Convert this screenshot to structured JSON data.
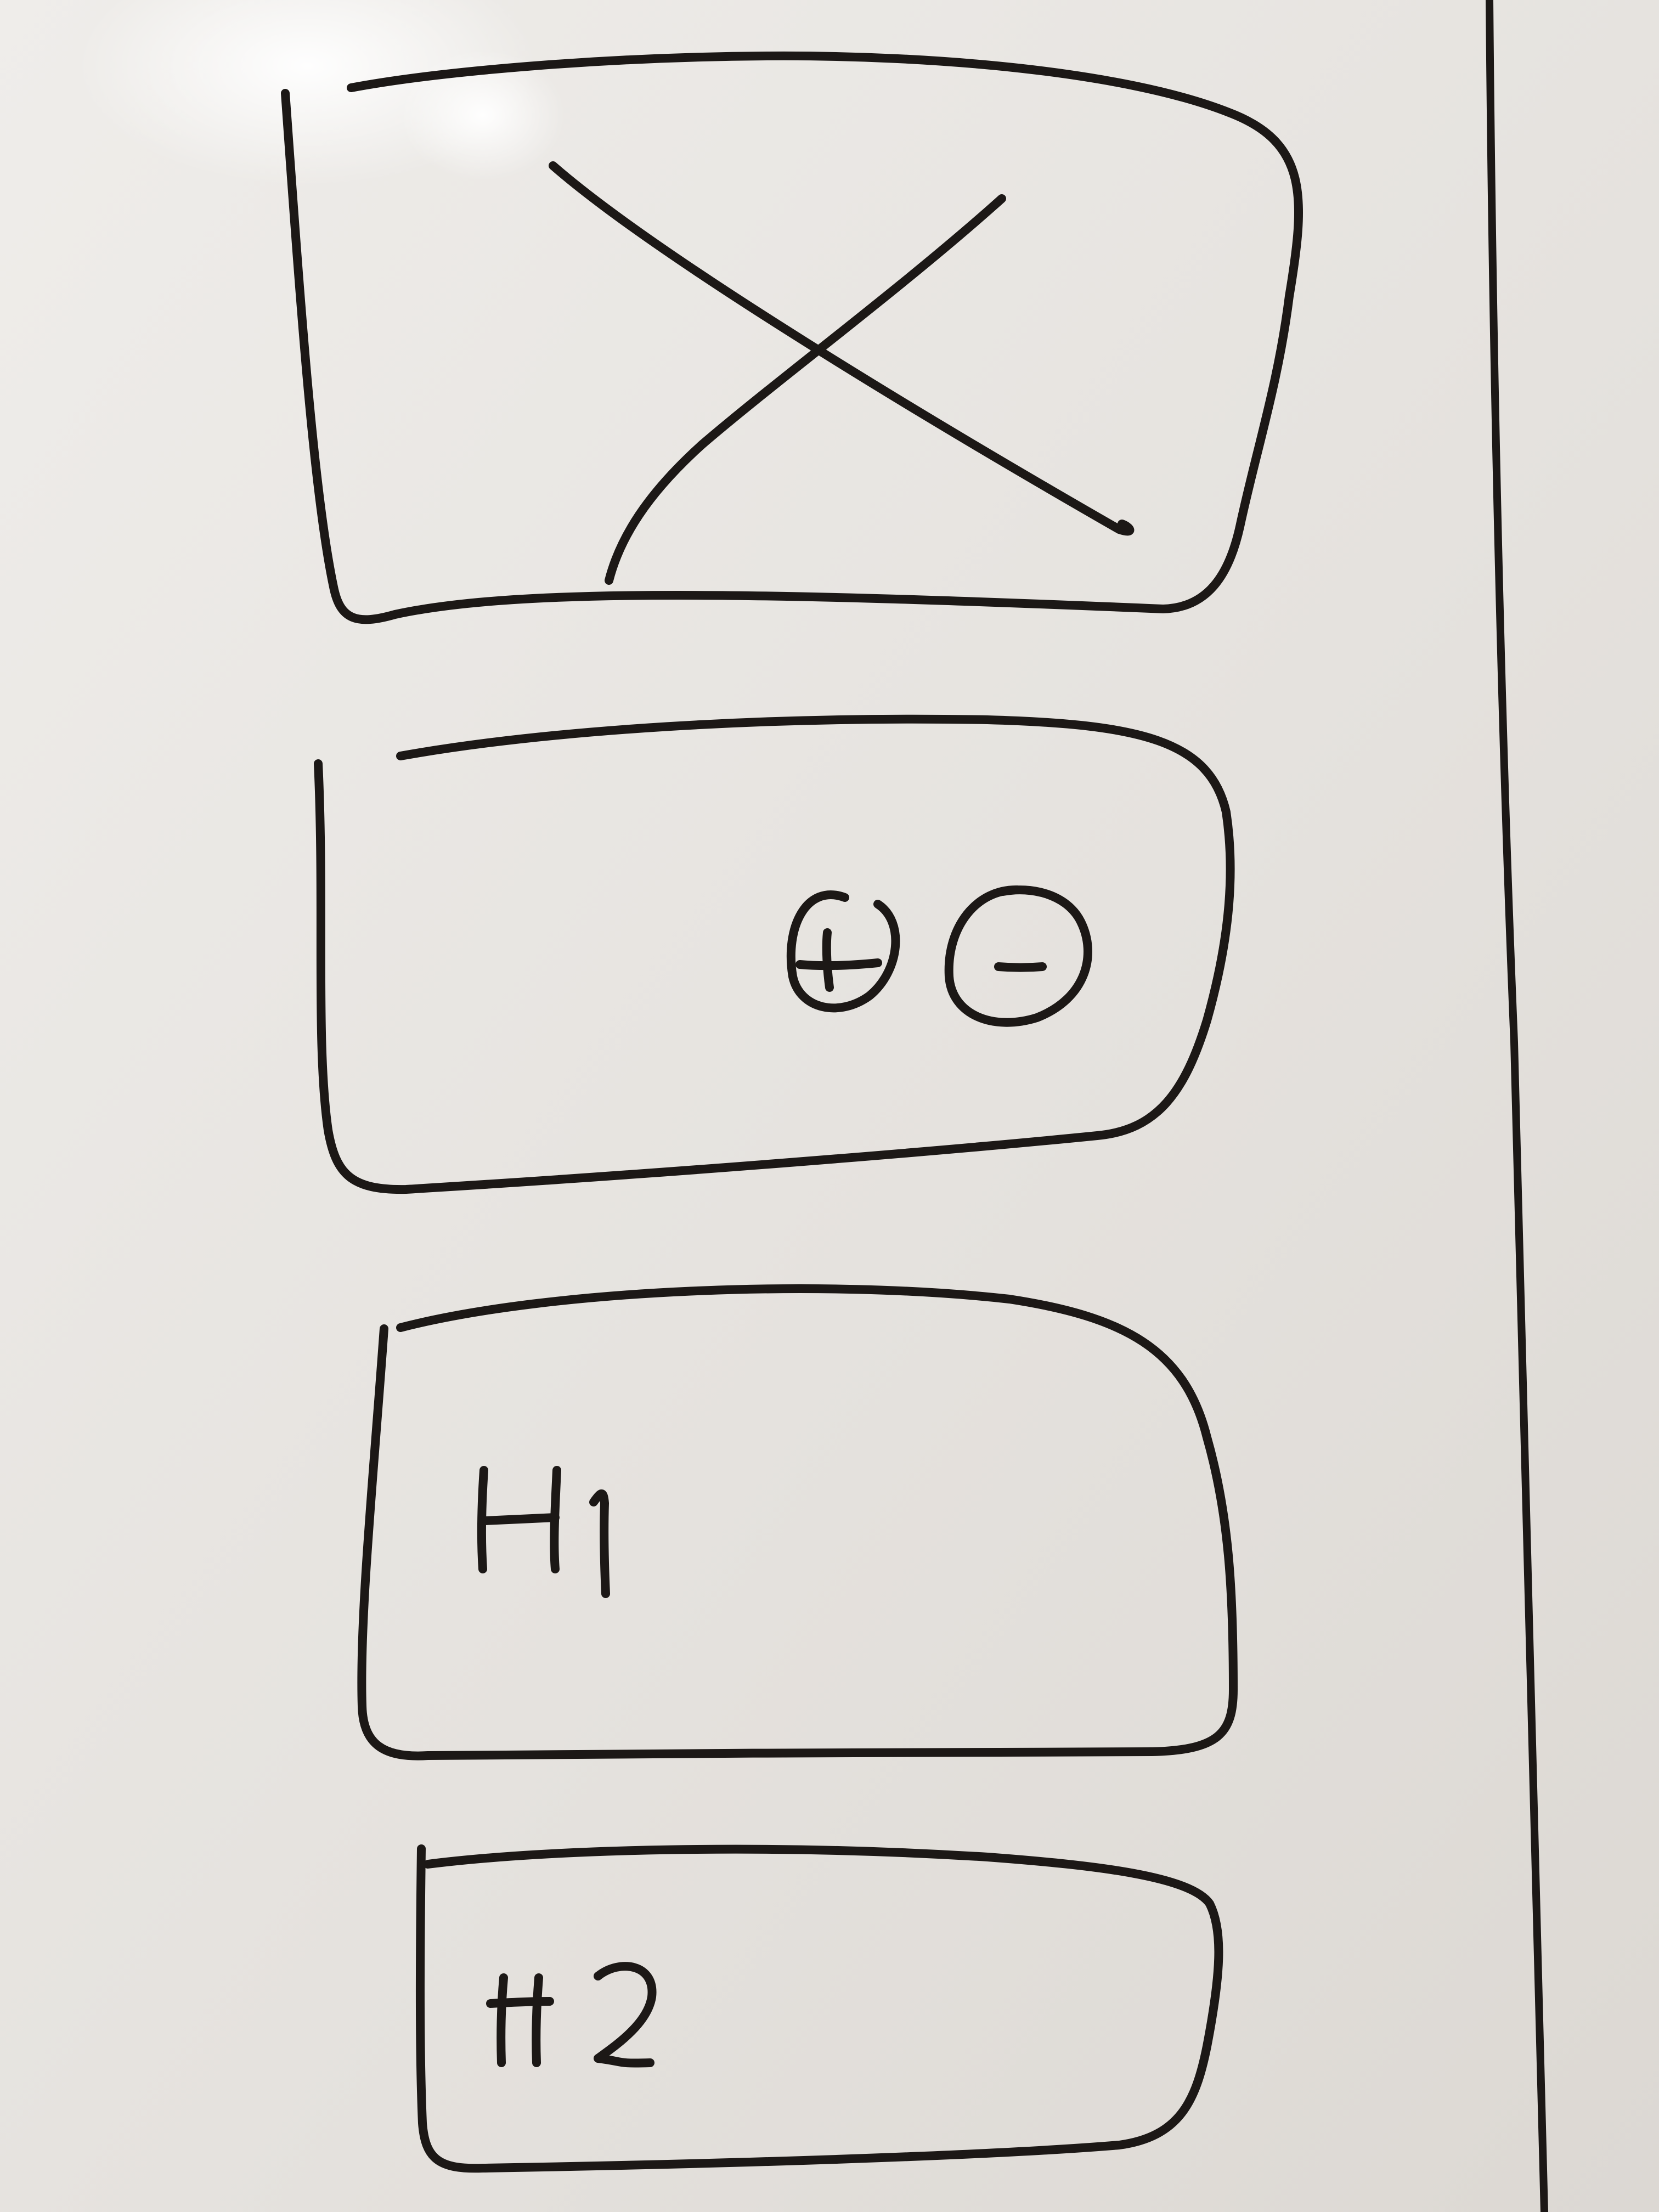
{
  "whiteboard": {
    "background": "#e7e4e0",
    "marker_color": "#1c1816"
  },
  "wireframe": {
    "image_placeholder": {
      "icon": "crossed-box-image-placeholder-icon"
    },
    "zoom_panel": {
      "zoom_in_icon": "circled-plus-icon",
      "zoom_out_icon": "circled-minus-icon"
    },
    "heading_1_panel": {
      "label": "H1"
    },
    "heading_2_panel": {
      "label": "H2"
    }
  }
}
